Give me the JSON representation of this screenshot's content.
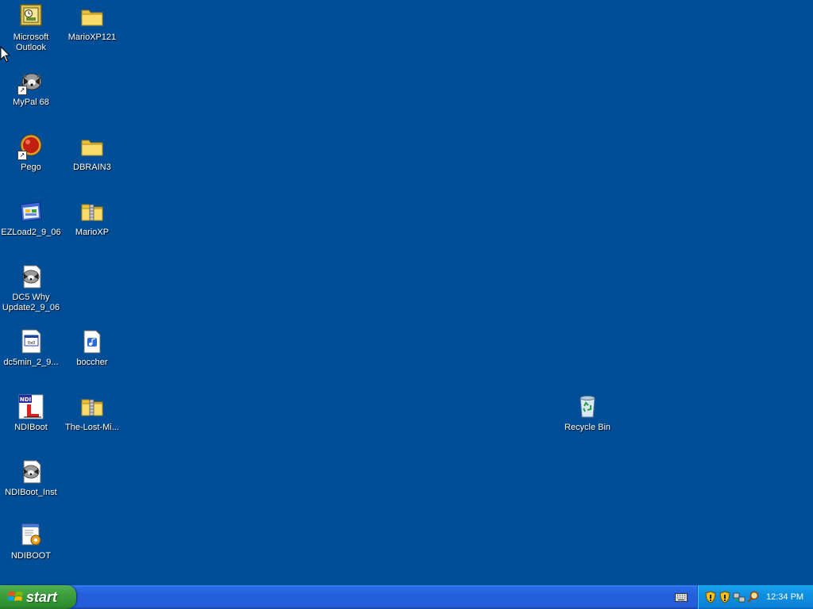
{
  "desktop": {
    "background_color": "#004e98",
    "icons": [
      {
        "label": "Microsoft Outlook",
        "icon": "outlook-icon"
      },
      {
        "label": "MarioXP121",
        "icon": "folder-icon"
      },
      {
        "label": "MyPal 68",
        "icon": "raccoon-shortcut-icon"
      },
      {
        "label": "Pego",
        "icon": "red-ball-shortcut-icon"
      },
      {
        "label": "DBRAIN3",
        "icon": "folder-icon"
      },
      {
        "label": "EZLoad2_9_06",
        "icon": "window-app-icon"
      },
      {
        "label": "MarioXP",
        "icon": "zip-folder-icon"
      },
      {
        "label": "DC5 Why Update2_9_06",
        "icon": "raccoon-document-icon"
      },
      {
        "label": "dc5min_2_9...",
        "icon": "executable-document-icon"
      },
      {
        "label": "boccher",
        "icon": "audio-document-icon"
      },
      {
        "label": "NDIBoot",
        "icon": "ndi-app-icon"
      },
      {
        "label": "The-Lost-Mi...",
        "icon": "zip-folder-icon"
      },
      {
        "label": "NDIBoot_Inst",
        "icon": "raccoon-document-icon"
      },
      {
        "label": "NDIBOOT",
        "icon": "settings-document-icon"
      },
      {
        "label": "Recycle Bin",
        "icon": "recycle-bin-icon"
      }
    ]
  },
  "taskbar": {
    "start_label": "start",
    "clock": "12:34 PM",
    "tray_icons": [
      "security-shield-icon",
      "security-shield-icon",
      "network-icon",
      "search-icon"
    ]
  },
  "colors": {
    "taskbar_blue": "#245edb",
    "start_green": "#3c9e3c",
    "tray_blue": "#0f8fe0"
  }
}
